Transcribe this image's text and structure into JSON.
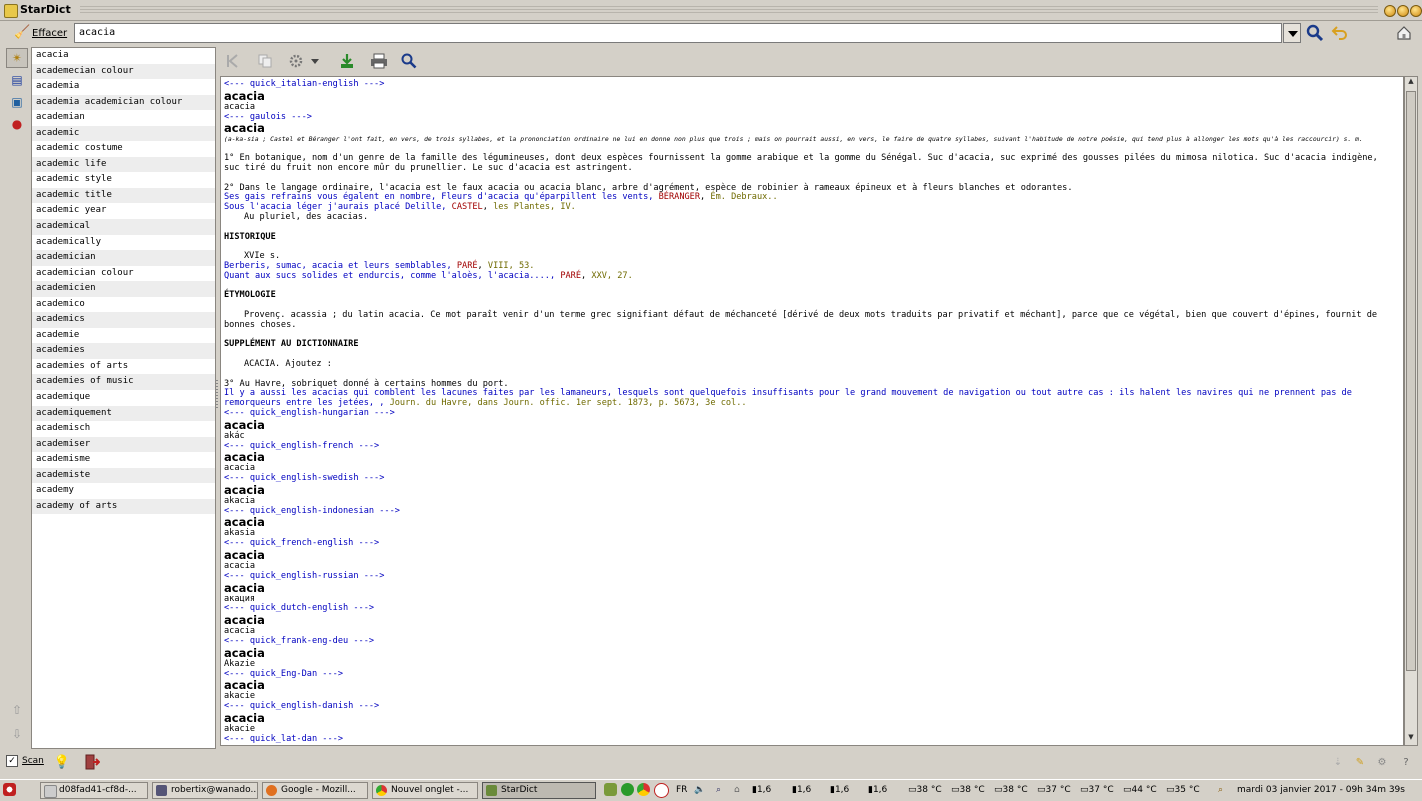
{
  "window": {
    "title": "StarDict"
  },
  "toolbar": {
    "clear_label": "Effacer",
    "search_value": "acacia"
  },
  "wordlist": [
    "acacia",
    "academecian colour",
    "academia",
    "academia academician colour",
    "academian",
    "academic",
    "academic costume",
    "academic life",
    "academic style",
    "academic title",
    "academic year",
    "academical",
    "academically",
    "academician",
    "academician colour",
    "academicien",
    "academico",
    "academics",
    "academie",
    "academies",
    "academies of arts",
    "academies of music",
    "academique",
    "academiquement",
    "academisch",
    "academiser",
    "academisme",
    "academiste",
    "academy",
    "academy of arts"
  ],
  "content": {
    "italian_header": "<--- quick_italian-english --->",
    "word": "acacia",
    "italian_trans": "acacia",
    "gaulois_header": "<--- gaulois --->",
    "gaulois_pron": "(a-ka-sia ; Castel et Béranger l'ont fait, en vers, de trois syllabes, et la prononciation ordinaire ne lui en donne non plus que trois ; mais on pourrait aussi, en vers, le faire de quatre syllabes, suivant l'habitude de notre poésie, qui tend plus à allonger les mots qu'à les raccourcir) s. m.",
    "def1_l1": "1° En botanique, nom d'un genre de la famille des légumineuses, dont deux espèces fournissent la gomme arabique et la gomme du Sénégal. Suc d'acacia, suc exprimé des gousses pilées du mimosa nilotica. Suc d'acacia indigène,",
    "def1_l2": "suc tiré du fruit non encore mûr du prunellier. Le suc d'acacia est astringent.",
    "def2": "2° Dans le langage ordinaire, l'acacia est le faux acacia ou acacia blanc, arbre d'agrément, espèce de robinier à rameaux épineux et à fleurs blanches et odorantes.",
    "cit1_text": "Ses gais refrains vous égalent en nombre, Fleurs d'acacia qu'éparpillent les vents,",
    "cit1_auth": "BÉRANGER",
    "cit1_src": "Ém. Debraux..",
    "cit2_text": "Sous l'acacia léger j'aurais placé Delille,",
    "cit2_auth": "CASTEL",
    "cit2_src": "les Plantes, IV.",
    "plural": "Au pluriel, des acacias.",
    "hist_title": "HISTORIQUE",
    "hist_century": "XVIe s.",
    "hist1_text": "Berberis, sumac, acacia et leurs semblables,",
    "hist1_auth": "PARÉ",
    "hist1_src": "VIII, 53.",
    "hist2_text": "Quant aux sucs solides et endurcis, comme l'aloès, l'acacia....,",
    "hist2_auth": "PARÉ",
    "hist2_src": "XXV, 27.",
    "etym_title": "ÉTYMOLOGIE",
    "etym_l1": "Provenç. acassia ; du latin acacia. Ce mot paraît venir d'un terme grec signifiant défaut de méchanceté [dérivé de deux mots traduits par privatif et méchant], parce que ce végétal, bien que couvert d'épines, fournit de",
    "etym_l2": "bonnes choses.",
    "supp_title": "SUPPLÉMENT AU DICTIONNAIRE",
    "supp_intro": "ACACIA. Ajoutez :",
    "supp_def": "3° Au Havre, sobriquet donné à certains hommes du port.",
    "supp_cit_l1": "Il y a aussi les acacias qui comblent les lacunes faites par les lamaneurs, lesquels sont quelquefois insuffisants pour le grand mouvement de navigation ou tout autre cas : ils halent les navires qui ne prennent pas de",
    "supp_cit_l2": "remorqueurs entre les jetées, ,",
    "supp_src": "Journ. du Havre, dans Journ. offic. 1er sept. 1873, p. 5673, 3e col..",
    "dicts": [
      {
        "header": "<--- quick_english-hungarian --->",
        "trans": "akác"
      },
      {
        "header": "<--- quick_english-french --->",
        "trans": "acacia"
      },
      {
        "header": "<--- quick_english-swedish --->",
        "trans": "akacia"
      },
      {
        "header": "<--- quick_english-indonesian --->",
        "trans": "akasia"
      },
      {
        "header": "<--- quick_french-english --->",
        "trans": "acacia"
      },
      {
        "header": "<--- quick_english-russian --->",
        "trans": "акация"
      },
      {
        "header": "<--- quick_dutch-english --->",
        "trans": "acacia"
      },
      {
        "header": "<--- quick_frank-eng-deu --->",
        "trans": "Akazie"
      },
      {
        "header": "<--- quick_Eng-Dan --->",
        "trans": "akacie"
      },
      {
        "header": "<--- quick_english-danish --->",
        "trans": "akacie"
      },
      {
        "header": "<--- quick_lat-dan --->",
        "trans": ""
      }
    ]
  },
  "bottombar": {
    "scan_label": "Scan"
  },
  "taskbar": {
    "tasks": [
      "d08fad41-cf8d-...",
      "robertix@wanado...",
      "Google - Mozill...",
      "Nouvel onglet -...",
      "StarDict"
    ],
    "lang": "FR",
    "loads": [
      "1,6",
      "1,6",
      "1,6",
      "1,6"
    ],
    "temps": [
      "38 °C",
      "38 °C",
      "38 °C",
      "37 °C",
      "37 °C",
      "44 °C",
      "35 °C"
    ],
    "clock": "mardi 03 janvier 2017 - 09h 34m 39s"
  },
  "colors": {
    "link": "#0000c0",
    "author": "#a00000",
    "source": "#6f6a00"
  }
}
